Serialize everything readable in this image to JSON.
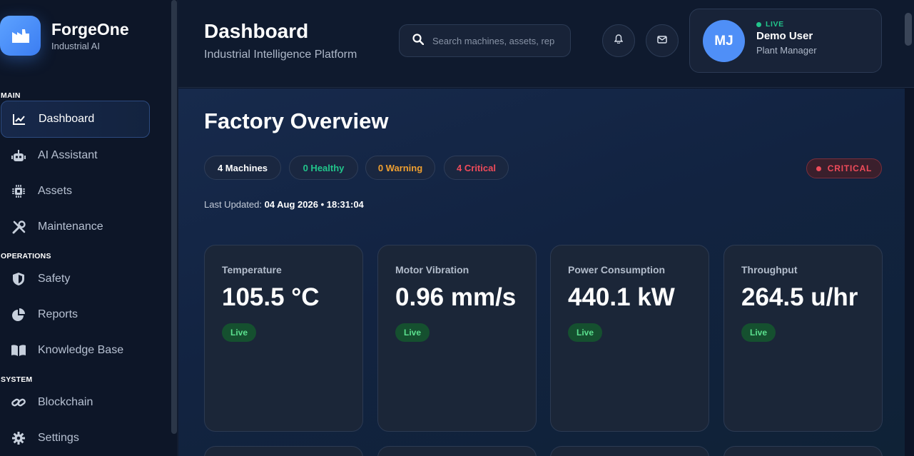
{
  "brand": {
    "name": "ForgeOne",
    "subtitle": "Industrial AI"
  },
  "sidebar": {
    "sections": [
      "MAIN",
      "OPERATIONS",
      "SYSTEM"
    ],
    "items": [
      {
        "label": "Dashboard",
        "icon": "chart-line-icon",
        "active": true
      },
      {
        "label": "AI Assistant",
        "icon": "robot-icon"
      },
      {
        "label": "Assets",
        "icon": "chip-icon"
      },
      {
        "label": "Maintenance",
        "icon": "tools-icon"
      },
      {
        "label": "Safety",
        "icon": "shield-icon"
      },
      {
        "label": "Reports",
        "icon": "pie-chart-icon"
      },
      {
        "label": "Knowledge Base",
        "icon": "book-icon"
      },
      {
        "label": "Blockchain",
        "icon": "link-icon"
      },
      {
        "label": "Settings",
        "icon": "gear-icon"
      }
    ]
  },
  "header": {
    "title": "Dashboard",
    "subtitle": "Industrial Intelligence Platform",
    "search_placeholder": "Search machines, assets, rep",
    "user": {
      "initials": "MJ",
      "status": "LIVE",
      "name": "Demo User",
      "role": "Plant Manager"
    }
  },
  "overview": {
    "title": "Factory Overview",
    "pills": {
      "machines": "4 Machines",
      "healthy": "0 Healthy",
      "warning": "0 Warning",
      "critical": "4 Critical"
    },
    "status": "CRITICAL",
    "last_updated_label": "Last Updated:",
    "last_updated_value": "04 Aug 2026 • 18:31:04"
  },
  "metrics": [
    {
      "label": "Temperature",
      "value": "105.5 °C",
      "badge": "Live"
    },
    {
      "label": "Motor Vibration",
      "value": "0.96 mm/s",
      "badge": "Live"
    },
    {
      "label": "Power Consumption",
      "value": "440.1 kW",
      "badge": "Live"
    },
    {
      "label": "Throughput",
      "value": "264.5 u/hr",
      "badge": "Live"
    }
  ],
  "colors": {
    "accent": "#4f8ff7",
    "healthy": "#22c58b",
    "warning": "#f0a030",
    "critical": "#ef4b5a",
    "live_badge": "#15502f"
  }
}
